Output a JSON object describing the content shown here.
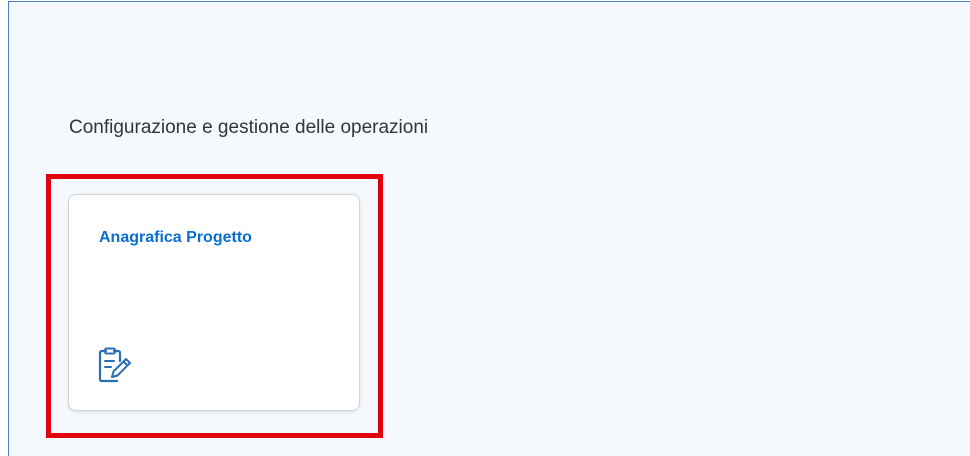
{
  "section": {
    "title": "Configurazione e gestione delle operazioni"
  },
  "tile": {
    "title": "Anagrafica Progetto",
    "icon": "document-edit-icon"
  },
  "colors": {
    "accent": "#0a6ed1",
    "highlight": "#e2000f",
    "frame_border": "#4a80c2",
    "background": "#f5f8fc"
  }
}
